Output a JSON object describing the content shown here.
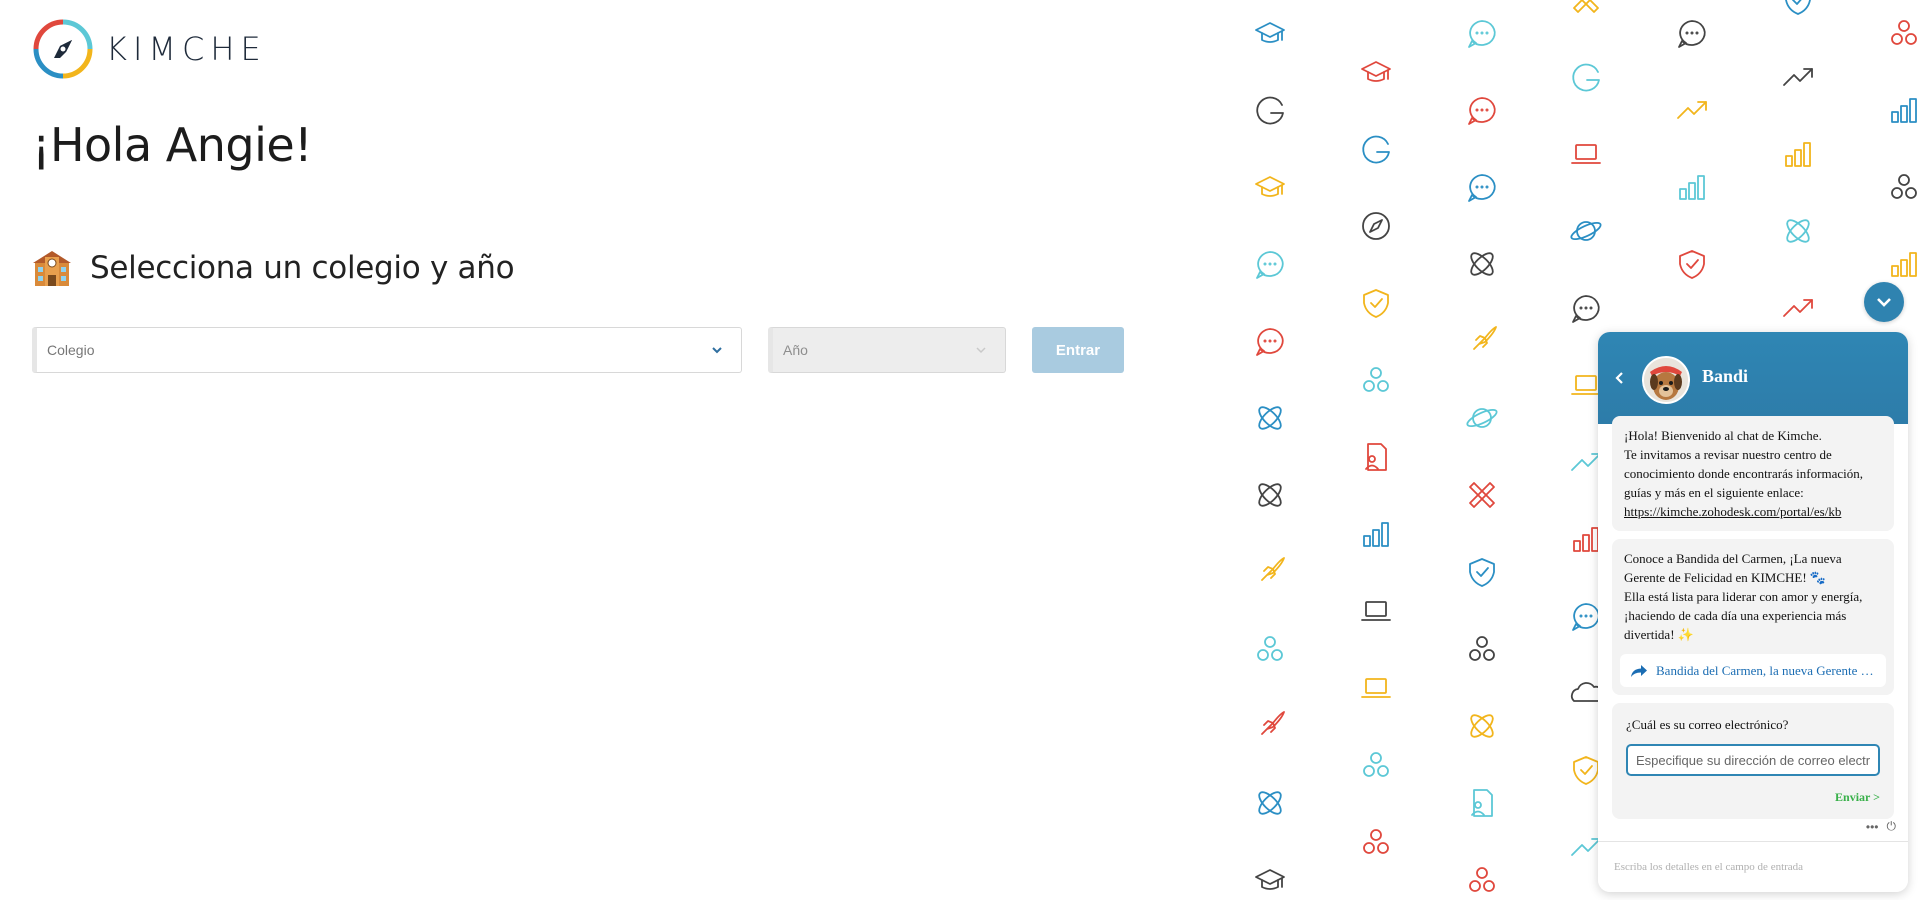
{
  "brand": {
    "name": "KIMCHE"
  },
  "greeting": "¡Hola Angie!",
  "section": {
    "title": "Selecciona un colegio y año"
  },
  "form": {
    "colegio_placeholder": "Colegio",
    "anio_placeholder": "Año",
    "submit_label": "Entrar"
  },
  "colors": {
    "accent": "#2f86b4",
    "button_disabled": "#a9cbe0",
    "send_green": "#38b049",
    "pattern_blue": "#2b8fc4",
    "pattern_cyan": "#5cc8d6",
    "pattern_red": "#e0483d",
    "pattern_yellow": "#f2b51c",
    "pattern_gray": "#444444"
  },
  "pattern_icons": {
    "columns": [
      [
        "graduation-cap",
        "google-g",
        "graduation-cap",
        "chat-bubble",
        "chat-bubble",
        "atom",
        "atom",
        "rocket",
        "people",
        "rocket",
        "atom",
        "graduation-cap"
      ],
      [
        "graduation-cap",
        "google-g",
        "compass",
        "shield-check",
        "people",
        "document-user",
        "bar-chart",
        "laptop",
        "laptop",
        "people",
        "people"
      ],
      [
        "chat-bubble",
        "chat-bubble",
        "chat-bubble",
        "atom",
        "rocket",
        "planet",
        "pencil-ruler",
        "shield-check",
        "people",
        "atom",
        "document-user",
        "people"
      ],
      [
        "pencil-ruler",
        "google-g",
        "laptop",
        "planet",
        "chat-bubble",
        "laptop",
        "trend-up",
        "bar-chart",
        "chat-bubble",
        "cloud",
        "shield-check",
        "trend-up"
      ],
      [
        "chat-bubble",
        "trend-up",
        "bar-chart",
        "shield-check"
      ],
      [
        "shield-check",
        "trend-up",
        "bar-chart",
        "atom",
        "trend-up"
      ],
      [
        "people",
        "bar-chart",
        "people",
        "bar-chart"
      ]
    ]
  },
  "chat": {
    "bot_name": "Bandi",
    "welcome": {
      "line1": "¡Hola! Bienvenido al chat de Kimche.",
      "line2": "Te invitamos a revisar nuestro centro de conocimiento donde encontrarás información, guías y más en el siguiente enlace:",
      "link": "https://kimche.zohodesk.com/portal/es/kb"
    },
    "intro": {
      "line1": "Conoce a Bandida del Carmen, ¡La nueva Gerente de Felicidad en KIMCHE! 🐾",
      "line2": "Ella está lista para liderar con amor y energía, ¡haciendo de cada día una experiencia más divertida! ✨",
      "link_label": "Bandida del Carmen, la nueva Gerente de Felicidad"
    },
    "email_prompt": "¿Cuál es su correo electrónico?",
    "email_placeholder": "Especifique su dirección de correo electrónico",
    "send_label": "Enviar >",
    "input_placeholder": "Escriba los detalles en el campo de entrada",
    "more_label": "•••",
    "power_label": "⏻"
  }
}
